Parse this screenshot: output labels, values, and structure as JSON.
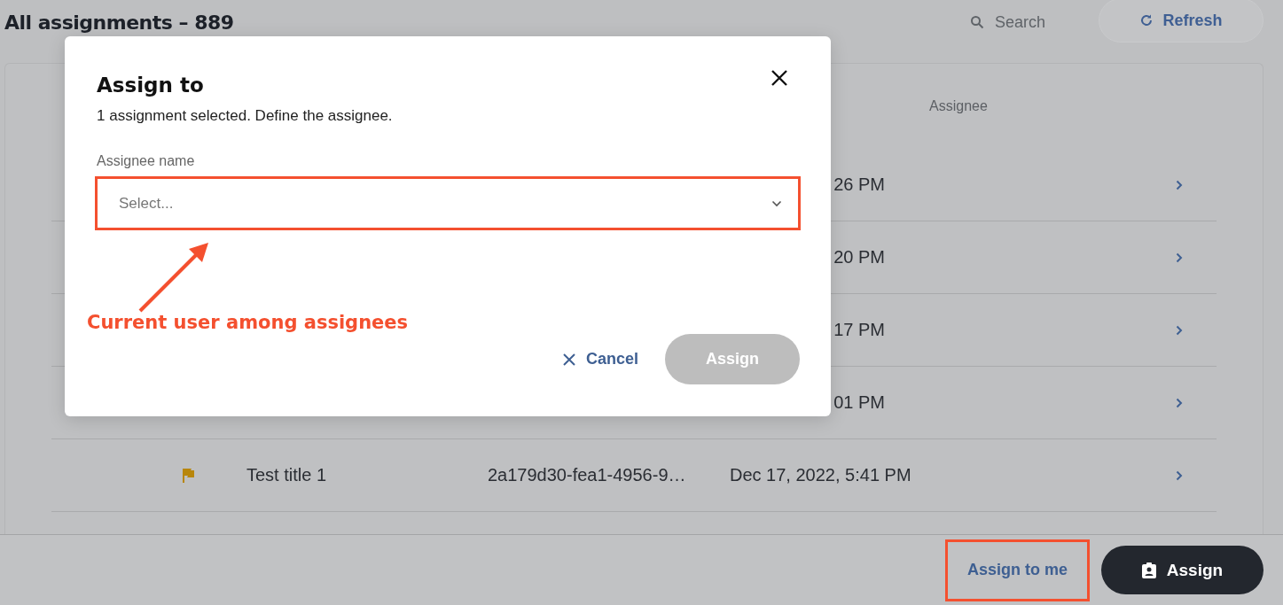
{
  "page": {
    "title": "All assignments – 889",
    "search": {
      "placeholder": "Search"
    },
    "refresh": "Refresh"
  },
  "table": {
    "columns": [
      {
        "label": "Assignee"
      }
    ],
    "rows": [
      {
        "kind": "covered",
        "date": "26 PM"
      },
      {
        "kind": "covered",
        "date": "20 PM"
      },
      {
        "kind": "covered",
        "date": "17 PM"
      },
      {
        "kind": "covered",
        "date": "01 PM"
      },
      {
        "kind": "full",
        "flagged": true,
        "title": "Test title 1",
        "id": "2a179d30-fea1-4956-9…",
        "date": "Dec 17, 2022, 5:41 PM"
      }
    ]
  },
  "footer": {
    "assign_to_me": "Assign to me",
    "assign": "Assign"
  },
  "dialog": {
    "title": "Assign to",
    "subtitle": "1 assignment selected. Define the assignee.",
    "field_label": "Assignee name",
    "placeholder": "Select...",
    "cancel": "Cancel",
    "assign": {
      "label": "Assign",
      "disabled": true
    }
  },
  "annotation": {
    "text": "Current user among assignees"
  }
}
